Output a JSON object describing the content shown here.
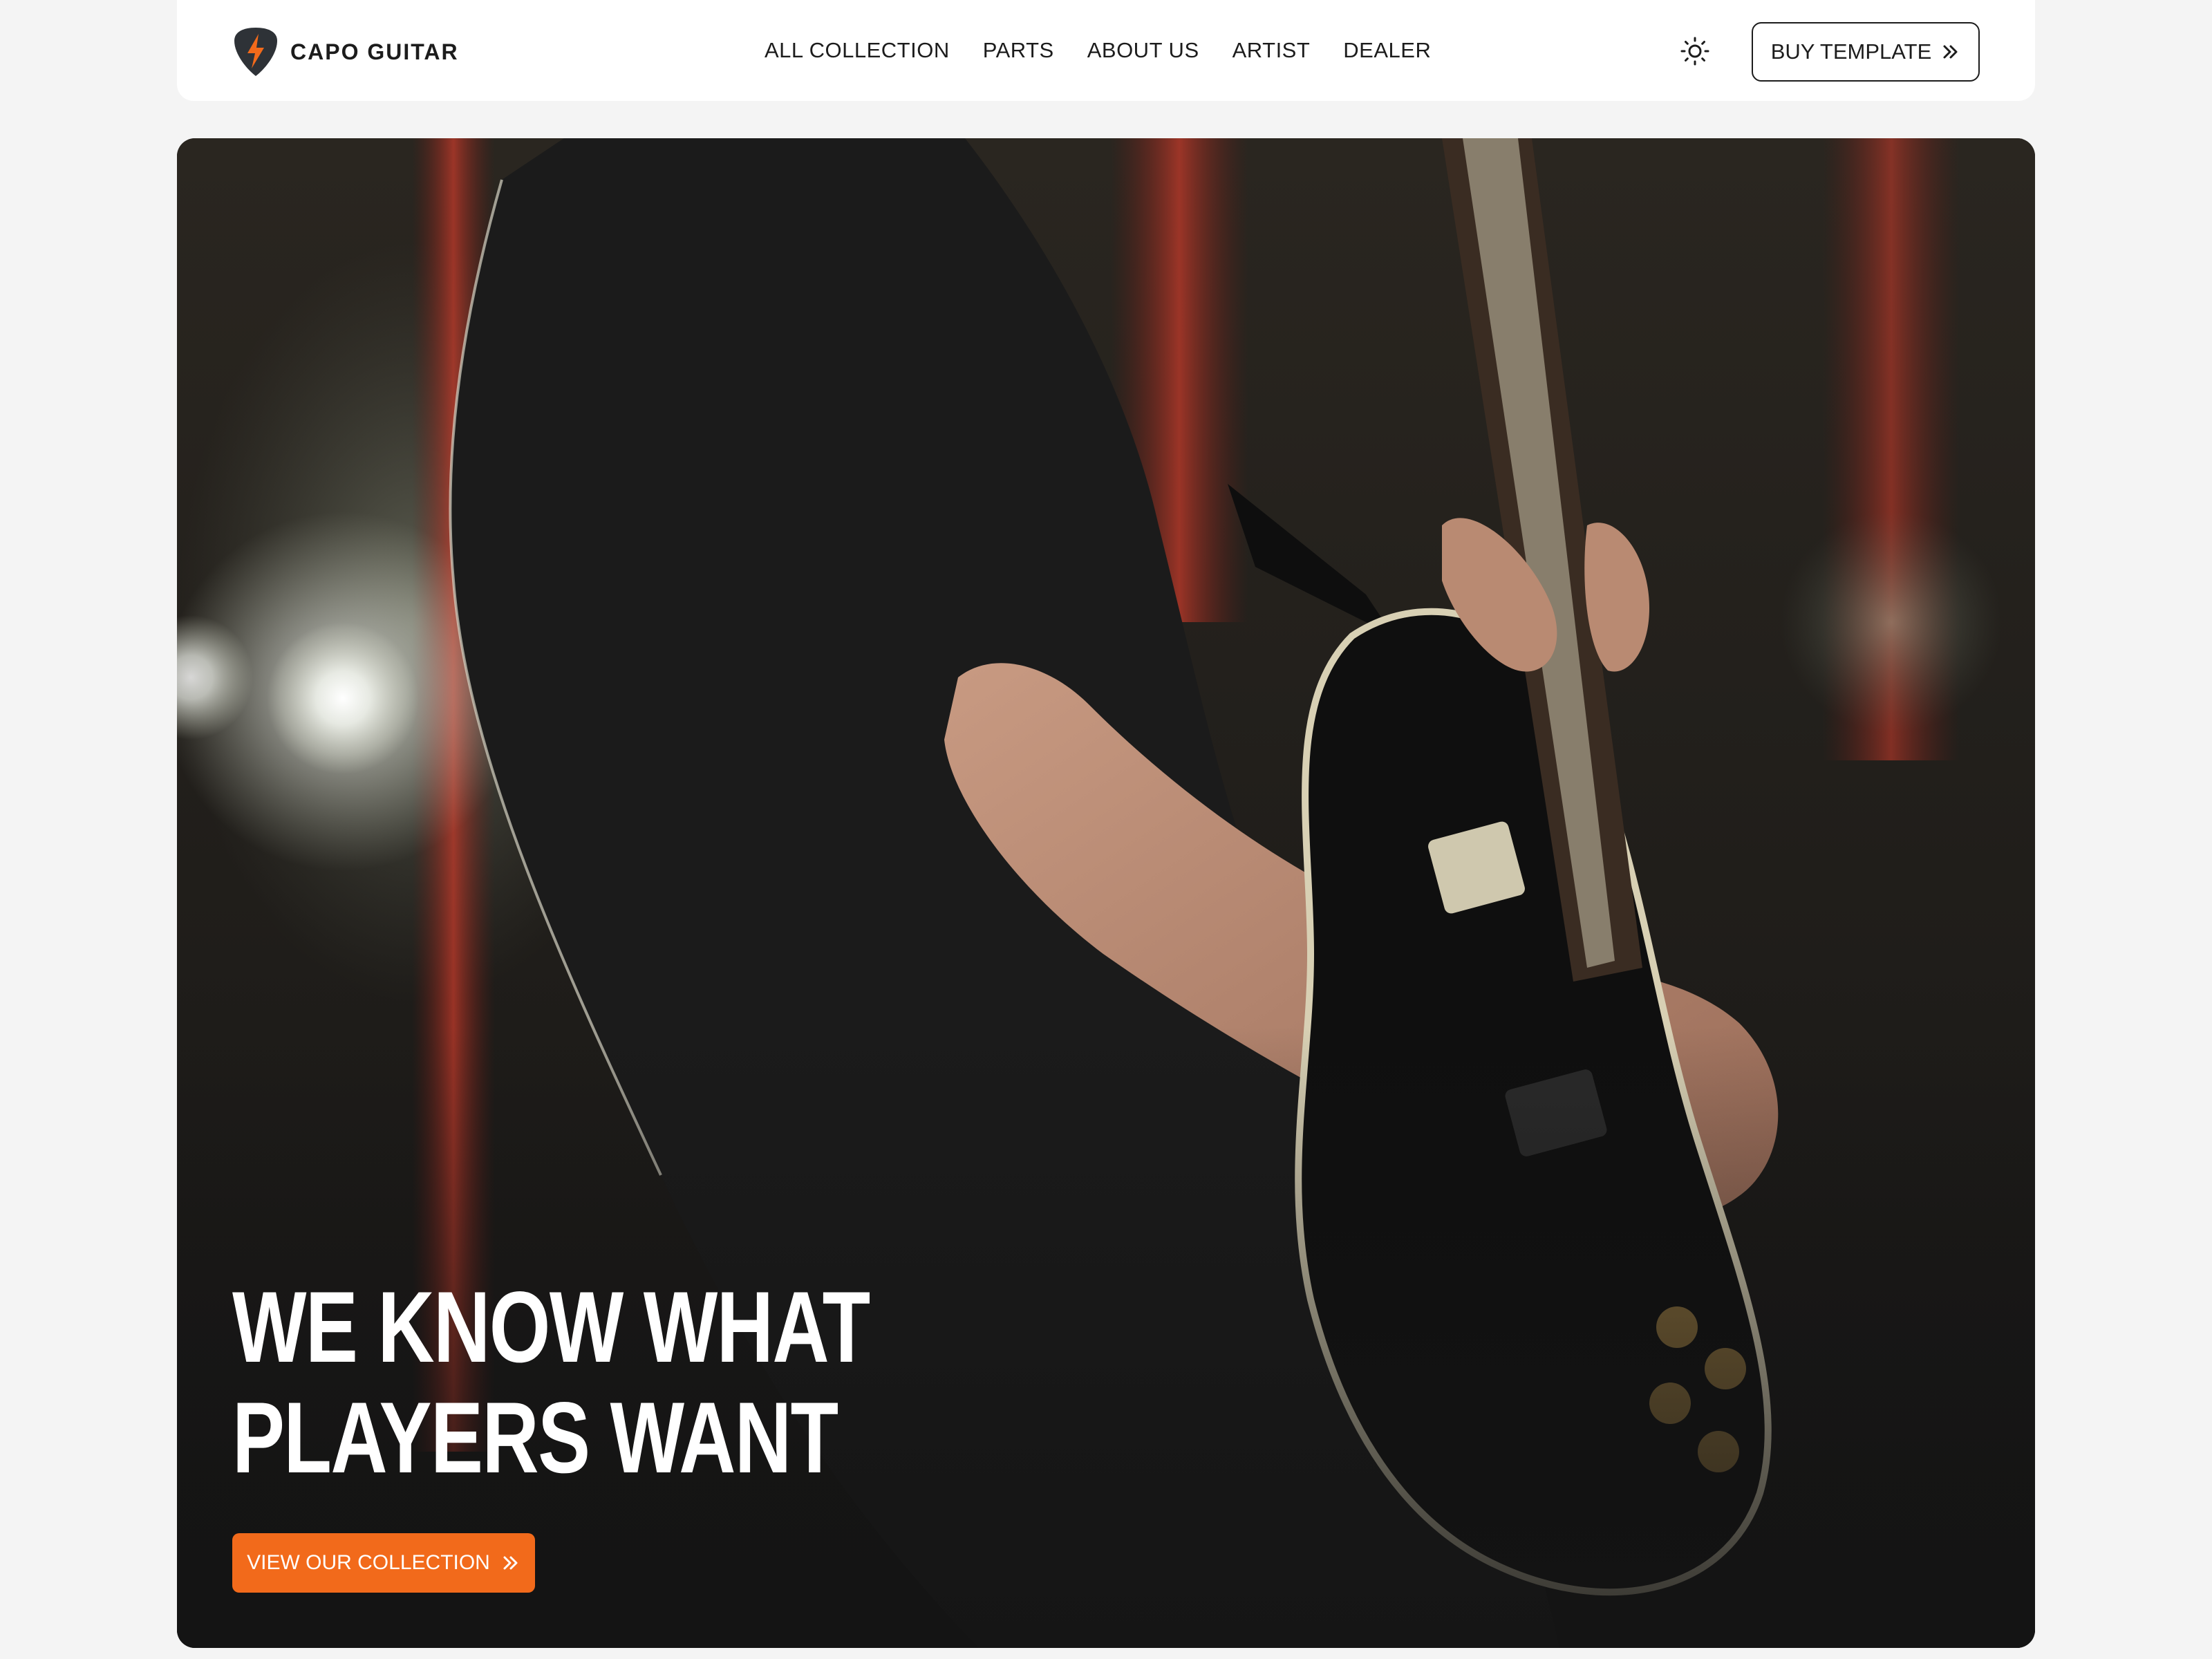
{
  "brand": {
    "name": "CAPO GUITAR",
    "logo_icon": "guitar-pick-bolt-icon"
  },
  "nav": {
    "links": [
      "ALL COLLECTION",
      "PARTS",
      "ABOUT US",
      "ARTIST",
      "DEALER"
    ],
    "theme_toggle_icon": "sun-icon",
    "buy_button": {
      "label": "BUY TEMPLATE",
      "icon": "double-chevron-right-icon"
    }
  },
  "hero": {
    "title_lines": [
      "WE KNOW WHAT",
      "PLAYERS WANT"
    ],
    "cta": {
      "label": "VIEW OUR COLLECTION",
      "icon": "double-chevron-right-icon"
    },
    "image": "guitarist-playing-electric-guitar-on-stage"
  },
  "colors": {
    "accent": "#f26a1b",
    "page_background": "#f4f4f4",
    "header_background": "#ffffff",
    "text_dark": "#1c1c1c",
    "hero_text": "#ffffff"
  }
}
